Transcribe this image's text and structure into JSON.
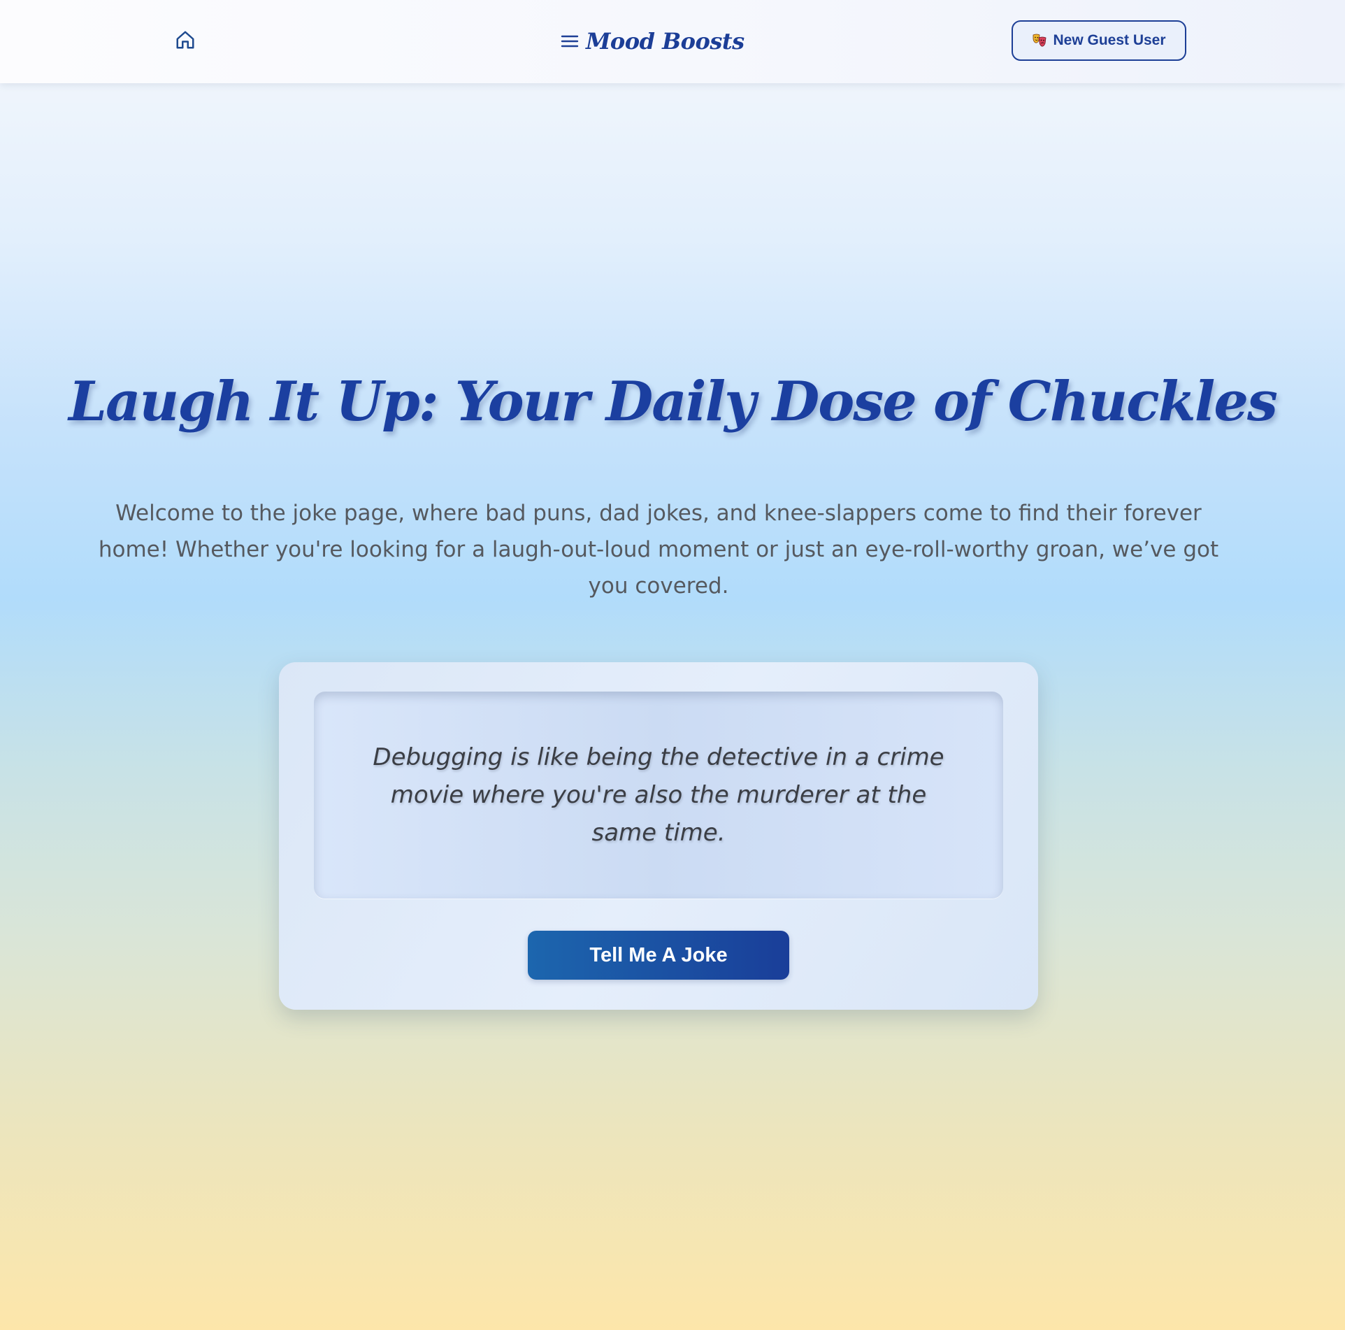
{
  "header": {
    "home_icon": "home-icon",
    "menu_icon": "hamburger-menu-icon",
    "brand": "Mood Boosts",
    "guest_icon": "theater-masks-icon",
    "guest_label": "New Guest User"
  },
  "hero": {
    "title": "Laugh It Up: Your Daily Dose of Chuckles",
    "intro": "Welcome to the joke page, where bad puns, dad jokes, and knee-slappers come to find their forever home! Whether you're looking for a laugh-out-loud moment or just an eye-roll-worthy groan, we’ve got you covered."
  },
  "joke_card": {
    "joke": "Debugging is like being the detective in a crime movie where you're also the murderer at the same time.",
    "button_label": "Tell Me A Joke"
  },
  "colors": {
    "primary": "#1b3fa0",
    "button_start": "#1c66ae",
    "button_end": "#1a3e99",
    "text_muted": "#55595f",
    "joke_text": "#3b3e45"
  }
}
